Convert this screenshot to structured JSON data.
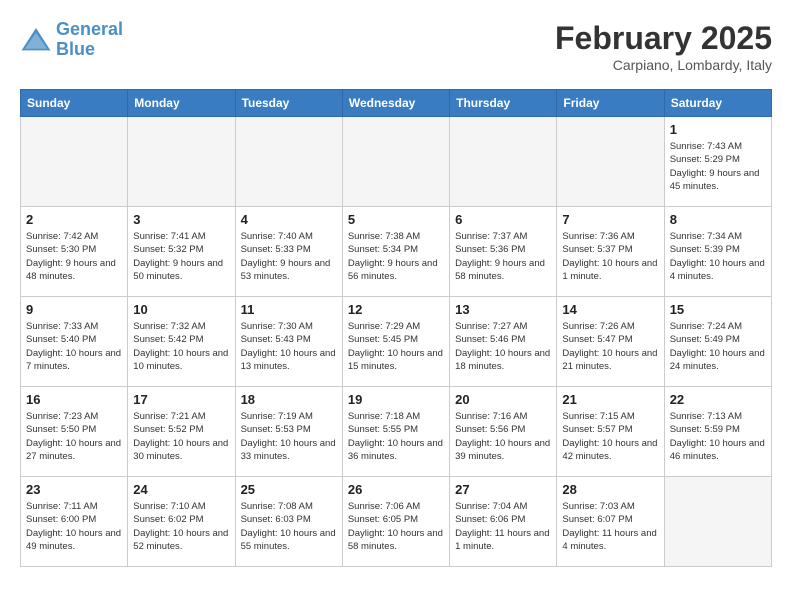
{
  "logo": {
    "text_general": "General",
    "text_blue": "Blue"
  },
  "header": {
    "month_title": "February 2025",
    "subtitle": "Carpiano, Lombardy, Italy"
  },
  "weekdays": [
    "Sunday",
    "Monday",
    "Tuesday",
    "Wednesday",
    "Thursday",
    "Friday",
    "Saturday"
  ],
  "weeks": [
    [
      {
        "day": "",
        "info": ""
      },
      {
        "day": "",
        "info": ""
      },
      {
        "day": "",
        "info": ""
      },
      {
        "day": "",
        "info": ""
      },
      {
        "day": "",
        "info": ""
      },
      {
        "day": "",
        "info": ""
      },
      {
        "day": "1",
        "info": "Sunrise: 7:43 AM\nSunset: 5:29 PM\nDaylight: 9 hours and 45 minutes."
      }
    ],
    [
      {
        "day": "2",
        "info": "Sunrise: 7:42 AM\nSunset: 5:30 PM\nDaylight: 9 hours and 48 minutes."
      },
      {
        "day": "3",
        "info": "Sunrise: 7:41 AM\nSunset: 5:32 PM\nDaylight: 9 hours and 50 minutes."
      },
      {
        "day": "4",
        "info": "Sunrise: 7:40 AM\nSunset: 5:33 PM\nDaylight: 9 hours and 53 minutes."
      },
      {
        "day": "5",
        "info": "Sunrise: 7:38 AM\nSunset: 5:34 PM\nDaylight: 9 hours and 56 minutes."
      },
      {
        "day": "6",
        "info": "Sunrise: 7:37 AM\nSunset: 5:36 PM\nDaylight: 9 hours and 58 minutes."
      },
      {
        "day": "7",
        "info": "Sunrise: 7:36 AM\nSunset: 5:37 PM\nDaylight: 10 hours and 1 minute."
      },
      {
        "day": "8",
        "info": "Sunrise: 7:34 AM\nSunset: 5:39 PM\nDaylight: 10 hours and 4 minutes."
      }
    ],
    [
      {
        "day": "9",
        "info": "Sunrise: 7:33 AM\nSunset: 5:40 PM\nDaylight: 10 hours and 7 minutes."
      },
      {
        "day": "10",
        "info": "Sunrise: 7:32 AM\nSunset: 5:42 PM\nDaylight: 10 hours and 10 minutes."
      },
      {
        "day": "11",
        "info": "Sunrise: 7:30 AM\nSunset: 5:43 PM\nDaylight: 10 hours and 13 minutes."
      },
      {
        "day": "12",
        "info": "Sunrise: 7:29 AM\nSunset: 5:45 PM\nDaylight: 10 hours and 15 minutes."
      },
      {
        "day": "13",
        "info": "Sunrise: 7:27 AM\nSunset: 5:46 PM\nDaylight: 10 hours and 18 minutes."
      },
      {
        "day": "14",
        "info": "Sunrise: 7:26 AM\nSunset: 5:47 PM\nDaylight: 10 hours and 21 minutes."
      },
      {
        "day": "15",
        "info": "Sunrise: 7:24 AM\nSunset: 5:49 PM\nDaylight: 10 hours and 24 minutes."
      }
    ],
    [
      {
        "day": "16",
        "info": "Sunrise: 7:23 AM\nSunset: 5:50 PM\nDaylight: 10 hours and 27 minutes."
      },
      {
        "day": "17",
        "info": "Sunrise: 7:21 AM\nSunset: 5:52 PM\nDaylight: 10 hours and 30 minutes."
      },
      {
        "day": "18",
        "info": "Sunrise: 7:19 AM\nSunset: 5:53 PM\nDaylight: 10 hours and 33 minutes."
      },
      {
        "day": "19",
        "info": "Sunrise: 7:18 AM\nSunset: 5:55 PM\nDaylight: 10 hours and 36 minutes."
      },
      {
        "day": "20",
        "info": "Sunrise: 7:16 AM\nSunset: 5:56 PM\nDaylight: 10 hours and 39 minutes."
      },
      {
        "day": "21",
        "info": "Sunrise: 7:15 AM\nSunset: 5:57 PM\nDaylight: 10 hours and 42 minutes."
      },
      {
        "day": "22",
        "info": "Sunrise: 7:13 AM\nSunset: 5:59 PM\nDaylight: 10 hours and 46 minutes."
      }
    ],
    [
      {
        "day": "23",
        "info": "Sunrise: 7:11 AM\nSunset: 6:00 PM\nDaylight: 10 hours and 49 minutes."
      },
      {
        "day": "24",
        "info": "Sunrise: 7:10 AM\nSunset: 6:02 PM\nDaylight: 10 hours and 52 minutes."
      },
      {
        "day": "25",
        "info": "Sunrise: 7:08 AM\nSunset: 6:03 PM\nDaylight: 10 hours and 55 minutes."
      },
      {
        "day": "26",
        "info": "Sunrise: 7:06 AM\nSunset: 6:05 PM\nDaylight: 10 hours and 58 minutes."
      },
      {
        "day": "27",
        "info": "Sunrise: 7:04 AM\nSunset: 6:06 PM\nDaylight: 11 hours and 1 minute."
      },
      {
        "day": "28",
        "info": "Sunrise: 7:03 AM\nSunset: 6:07 PM\nDaylight: 11 hours and 4 minutes."
      },
      {
        "day": "",
        "info": ""
      }
    ]
  ]
}
